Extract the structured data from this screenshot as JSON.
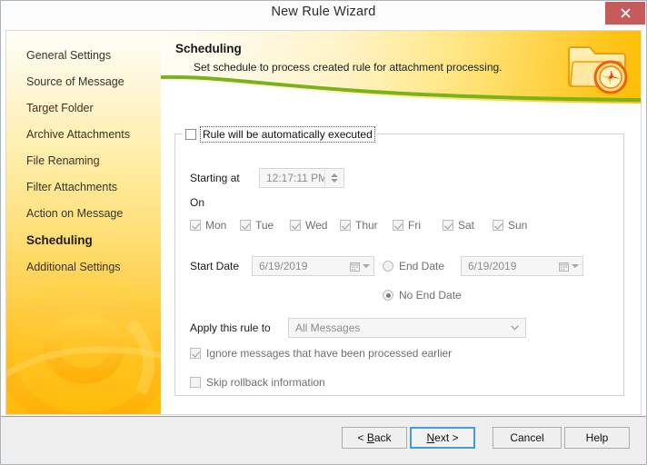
{
  "window": {
    "title": "New Rule Wizard",
    "close_label": "x",
    "close_icon": "close-icon"
  },
  "sidebar": {
    "items": [
      {
        "label": "General Settings",
        "active": false
      },
      {
        "label": "Source of Message",
        "active": false
      },
      {
        "label": "Target Folder",
        "active": false
      },
      {
        "label": "Archive Attachments",
        "active": false
      },
      {
        "label": "File Renaming",
        "active": false
      },
      {
        "label": "Filter Attachments",
        "active": false
      },
      {
        "label": "Action on Message",
        "active": false
      },
      {
        "label": "Scheduling",
        "active": true
      },
      {
        "label": "Additional Settings",
        "active": false
      }
    ],
    "watermark_icon": "at-symbol-watermark"
  },
  "banner": {
    "title": "Scheduling",
    "subtitle": "Set schedule to process created rule for attachment processing.",
    "icon": "folder-clock-icon"
  },
  "form": {
    "group_checkbox_label": "Rule will be automatically executed",
    "group_checkbox_checked": false,
    "starting_at_label": "Starting at",
    "starting_at_value": "12:17:11 PM",
    "on_label": "On",
    "days": [
      {
        "label": "Mon",
        "checked": true
      },
      {
        "label": "Tue",
        "checked": true
      },
      {
        "label": "Wed",
        "checked": true
      },
      {
        "label": "Thur",
        "checked": true
      },
      {
        "label": "Fri",
        "checked": true
      },
      {
        "label": "Sat",
        "checked": true
      },
      {
        "label": "Sun",
        "checked": true
      }
    ],
    "start_date_label": "Start Date",
    "start_date_value": "6/19/2019",
    "end_date_label": "End Date",
    "end_date_value": "6/19/2019",
    "end_date_selected": false,
    "no_end_date_label": "No End Date",
    "no_end_date_selected": true,
    "apply_label": "Apply this rule to",
    "apply_value": "All Messages",
    "apply_options": [
      "All Messages"
    ],
    "ignore_label": "Ignore messages that have been processed earlier",
    "ignore_checked": true,
    "skip_label": "Skip rollback information",
    "skip_checked": false
  },
  "footer": {
    "back": "< Back",
    "back_prefix": "< ",
    "back_mnemonic": "B",
    "back_suffix": "ack",
    "next_prefix": "",
    "next_mnemonic": "N",
    "next_suffix": "ext >",
    "cancel": "Cancel",
    "help": "Help"
  },
  "colors": {
    "accent_orange": "#ffbe06",
    "close_red": "#c75b5b",
    "focus_blue": "#3f9bdc",
    "swoosh_green": "#7ab317"
  }
}
